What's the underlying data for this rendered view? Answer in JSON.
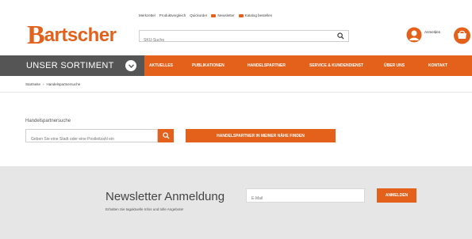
{
  "header": {
    "top_links": [
      {
        "label": "Merkzettel",
        "dot": ""
      },
      {
        "label": "Produktvergleich",
        "dot": ""
      },
      {
        "label": "Quickorder",
        "dot": ""
      },
      {
        "label": "Newsletter",
        "dot": "#e4611c"
      },
      {
        "label": "Katalog bestellen",
        "dot": "#e4611c"
      }
    ],
    "logo_mark": "B",
    "logo_text": "artscher",
    "search_placeholder": "SKU-Suche",
    "login_label": "Anmelden"
  },
  "nav": {
    "sortiment_label": "UNSER SORTIMENT",
    "items": [
      "AKTUELLES",
      "PUBLIKATIONEN",
      "HANDELSPARTNER",
      "SERVICE & KUNDENDIENST",
      "ÜBER UNS",
      "KONTAKT"
    ]
  },
  "breadcrumb": {
    "items": [
      "Startseite",
      "Handelspartnersuche"
    ],
    "separator": "›"
  },
  "dealer_search": {
    "label": "Handelspartnersuche",
    "input_placeholder": "Geben Sie eine Stadt oder eine Postleitzahl ein",
    "find_button": "HANDELSPARTNER IN MEINER NÄHE FINDEN"
  },
  "newsletter": {
    "title": "Newsletter Anmeldung",
    "subtitle": "Erhalten Sie tagaktuelle Infos und tolle Angebote!",
    "email_placeholder": "E-Mail",
    "button": "ANMELDEN"
  },
  "colors": {
    "accent": "#e4611c",
    "nav_dark": "#555555",
    "band": "#e6e6e6"
  },
  "icons": [
    "search-icon",
    "user-icon",
    "cart-icon",
    "chevron-down-icon"
  ]
}
